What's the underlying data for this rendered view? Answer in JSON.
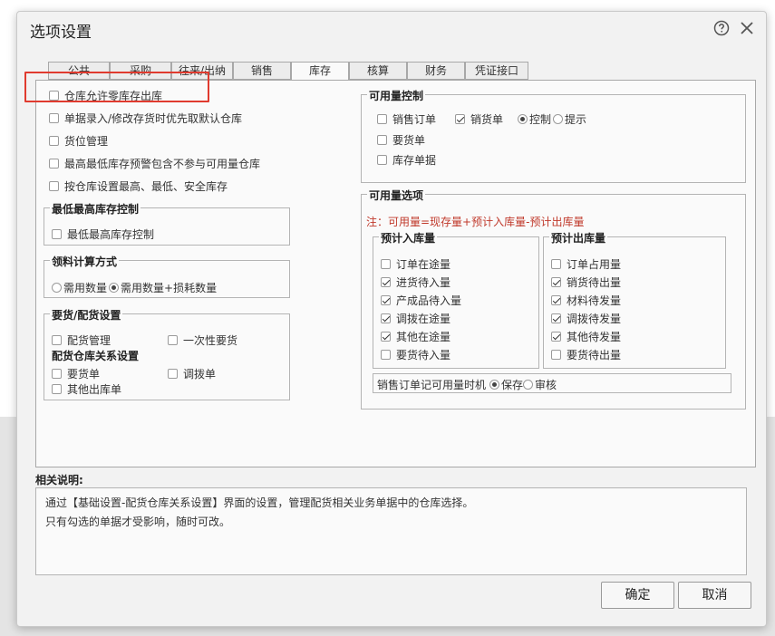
{
  "dialog": {
    "title": "选项设置",
    "help_icon": "help-circle-icon",
    "close_icon": "close-icon"
  },
  "tabs": [
    {
      "label": "公共"
    },
    {
      "label": "采购"
    },
    {
      "label": "往来/出纳"
    },
    {
      "label": "销售"
    },
    {
      "label": "库存"
    },
    {
      "label": "核算"
    },
    {
      "label": "财务"
    },
    {
      "label": "凭证接口"
    }
  ],
  "active_tab": "库存",
  "left": {
    "options": [
      {
        "label": "仓库允许零库存出库",
        "checked": false
      },
      {
        "label": "单据录入/修改存货时优先取默认仓库",
        "checked": false
      },
      {
        "label": "货位管理",
        "checked": false
      },
      {
        "label": "最高最低库存预警包含不参与可用量仓库",
        "checked": false
      },
      {
        "label": "按仓库设置最高、最低、安全库存",
        "checked": false
      }
    ],
    "stock_limit": {
      "title": "最低最高库存控制",
      "option": {
        "label": "最低最高库存控制",
        "checked": false
      }
    },
    "material_calc": {
      "title": "领料计算方式",
      "radio1": "需用数量",
      "radio2": "需用数量+损耗数量",
      "selected": "需用数量+损耗数量"
    },
    "distribution": {
      "title": "要货/配货设置",
      "option1": {
        "label": "配货管理",
        "checked": false
      },
      "option2": {
        "label": "一次性要货",
        "checked": false
      },
      "subtitle": "配货仓库关系设置",
      "option3": {
        "label": "要货单",
        "checked": false
      },
      "option4": {
        "label": "调拨单",
        "checked": false
      },
      "option5": {
        "label": "其他出库单",
        "checked": false
      }
    }
  },
  "right": {
    "available_control": {
      "title": "可用量控制",
      "sales_order": {
        "label": "销售订单",
        "checked": false
      },
      "delivery_note": {
        "label": "销货单",
        "checked": true
      },
      "radio_control": "控制",
      "radio_hint": "提示",
      "selected": "控制",
      "request_order": {
        "label": "要货单",
        "checked": false
      },
      "stock_doc": {
        "label": "库存单据",
        "checked": false
      }
    },
    "available_options": {
      "title": "可用量选项",
      "note": "注：可用量=现存量+预计入库量-预计出库量",
      "incoming": {
        "title": "预计入库量",
        "items": [
          {
            "label": "订单在途量",
            "checked": false
          },
          {
            "label": "进货待入量",
            "checked": true
          },
          {
            "label": "产成品待入量",
            "checked": true
          },
          {
            "label": "调拨在途量",
            "checked": true
          },
          {
            "label": "其他在途量",
            "checked": true
          },
          {
            "label": "要货待入量",
            "checked": false
          }
        ]
      },
      "outgoing": {
        "title": "预计出库量",
        "items": [
          {
            "label": "订单占用量",
            "checked": false
          },
          {
            "label": "销货待出量",
            "checked": true
          },
          {
            "label": "材料待发量",
            "checked": true
          },
          {
            "label": "调拨待发量",
            "checked": true
          },
          {
            "label": "其他待发量",
            "checked": true
          },
          {
            "label": "要货待出量",
            "checked": false
          }
        ]
      },
      "timing": {
        "label": "销售订单记可用量时机",
        "radio1": "保存",
        "radio2": "审核",
        "selected": "保存"
      }
    }
  },
  "description": {
    "title": "相关说明:",
    "line1": "通过【基础设置-配货仓库关系设置】界面的设置，管理配货相关业务单据中的仓库选择。",
    "line2": "只有勾选的单据才受影响，随时可改。"
  },
  "buttons": {
    "ok": "确定",
    "cancel": "取消"
  },
  "colors": {
    "highlight": "#e03b2f",
    "note_text": "#c0392b"
  }
}
